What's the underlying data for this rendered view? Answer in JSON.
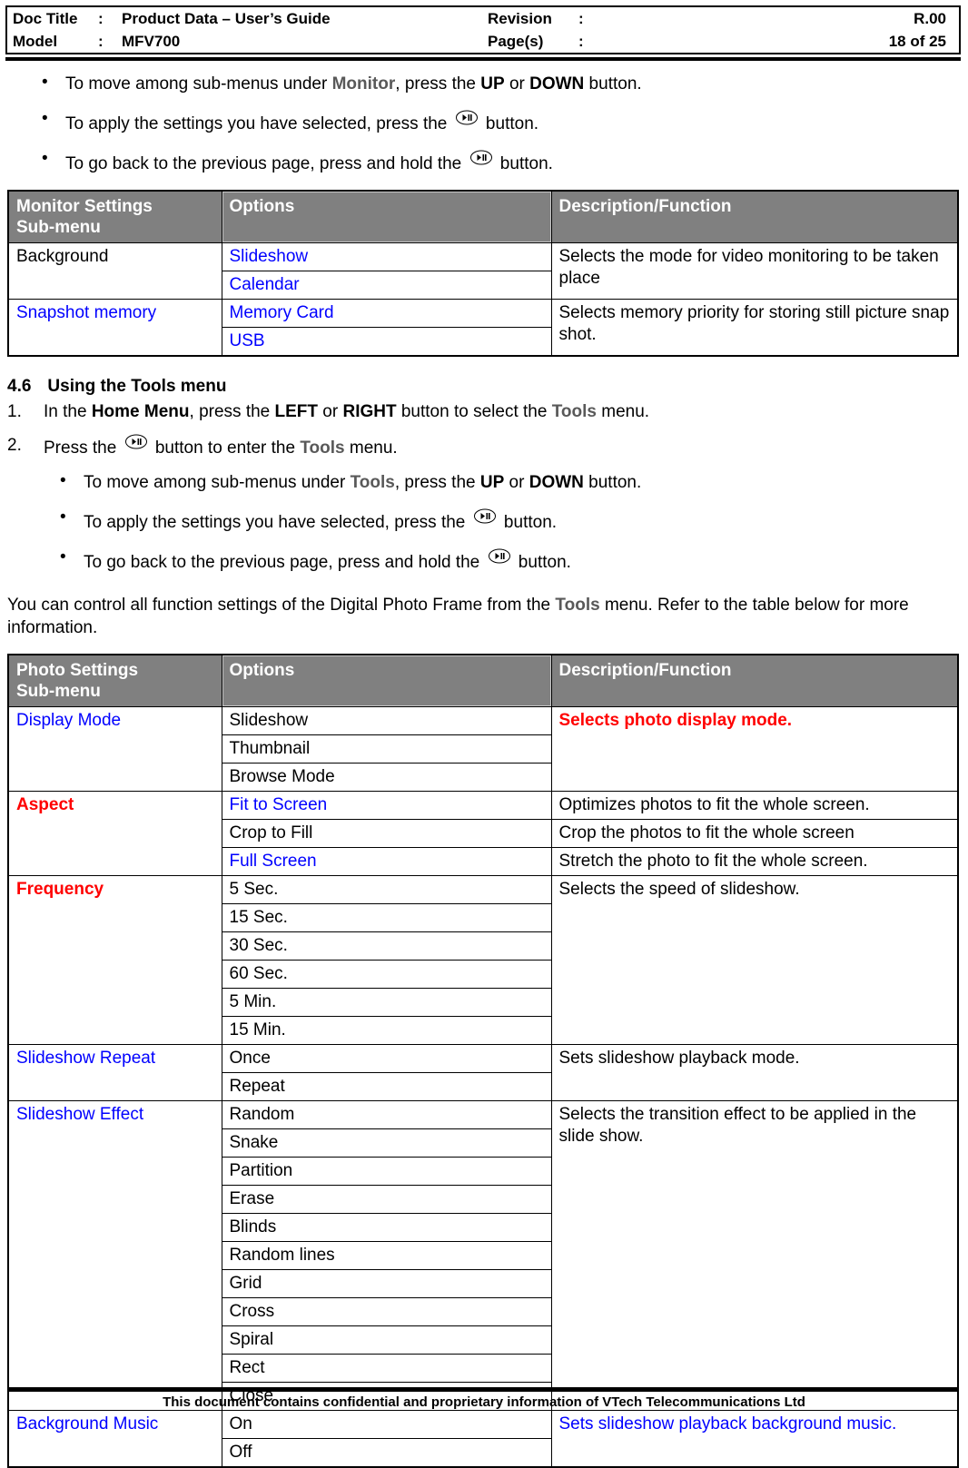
{
  "doc_header": {
    "doc_title_label": "Doc Title",
    "doc_title_colon": ":",
    "doc_title_value": "Product Data – User’s Guide",
    "model_label": "Model",
    "model_colon": ":",
    "model_value": "MFV700",
    "revision_label": "Revision",
    "revision_colon": ":",
    "revision_value": "R.00",
    "pages_label": "Page(s)",
    "pages_colon": ":",
    "pages_value": "18 of 25"
  },
  "monitor_bullets": [
    {
      "pre": "To move among sub-menus under ",
      "keyword": "Monitor",
      "mid": ", press the ",
      "bold1": "UP",
      "mid2": " or ",
      "bold2": "DOWN",
      "post": " button."
    },
    {
      "pre": "To apply the settings you have selected, press the ",
      "icon": "play-pause-button-icon",
      "post": " button."
    },
    {
      "pre": "To go back to the previous page, press and hold the ",
      "icon": "play-pause-button-icon",
      "post": " button."
    }
  ],
  "monitor_table": {
    "headers": [
      "Monitor Settings Sub-menu",
      "Options",
      "Description/Function"
    ],
    "header_line1": "Monitor Settings",
    "header_line2": "Sub-menu",
    "rows": [
      {
        "submenu": "Background",
        "submenu_color": "black",
        "options": [
          {
            "text": "Slideshow",
            "color": "blue"
          },
          {
            "text": "Calendar",
            "color": "blue"
          }
        ],
        "description": "Selects the mode for video monitoring to be taken place",
        "description_color": "black"
      },
      {
        "submenu": "Snapshot memory",
        "submenu_color": "blue",
        "options": [
          {
            "text": "Memory Card",
            "color": "blue"
          },
          {
            "text": "USB",
            "color": "blue"
          }
        ],
        "description": "Selects memory priority for storing still picture snap shot.",
        "description_color": "black"
      }
    ]
  },
  "section": {
    "number": "4.6",
    "title": "Using the Tools menu",
    "step1": {
      "pre": "In the ",
      "bold1": "Home Menu",
      "mid1": ", press the ",
      "bold2": "LEFT",
      "mid2": " or ",
      "bold3": "RIGHT",
      "mid3": " button to select the ",
      "keyword": "Tools",
      "post": " menu."
    },
    "step2": {
      "pre": "Press the ",
      "icon": "play-pause-button-icon",
      "mid": " button to enter the ",
      "keyword": "Tools",
      "post": " menu."
    }
  },
  "tools_bullets": [
    {
      "pre": "To move among sub-menus under ",
      "keyword": "Tools",
      "mid": ", press the ",
      "bold1": "UP",
      "mid2": " or ",
      "bold2": "DOWN",
      "post": " button."
    },
    {
      "pre": "To apply the settings you have selected, press the ",
      "icon": "play-pause-button-icon",
      "post": " button."
    },
    {
      "pre": "To go back to the previous page, press and hold the ",
      "icon": "play-pause-button-icon",
      "post": " button."
    }
  ],
  "intro_paragraph": {
    "pre": "You can control all function settings of the Digital Photo Frame from the ",
    "keyword": "Tools",
    "post": " menu. Refer to the table below for more information."
  },
  "photo_table": {
    "header_line1": "Photo Settings",
    "header_line2": "Sub-menu",
    "header_options": "Options",
    "header_description": "Description/Function",
    "rows": [
      {
        "submenu": "Display Mode",
        "submenu_color": "blue",
        "options": [
          {
            "text": "Slideshow",
            "color": "black"
          },
          {
            "text": "Thumbnail",
            "color": "black"
          },
          {
            "text": "Browse Mode",
            "color": "black"
          }
        ],
        "descriptions": [
          {
            "text": "Selects photo display mode.",
            "color": "red",
            "span": 3
          }
        ]
      },
      {
        "submenu": "Aspect",
        "submenu_color": "red",
        "options": [
          {
            "text": "Fit to Screen",
            "color": "blue"
          },
          {
            "text": "Crop to Fill",
            "color": "black"
          },
          {
            "text": "Full Screen",
            "color": "blue"
          }
        ],
        "descriptions": [
          {
            "text": "Optimizes photos to fit the whole screen.",
            "color": "black",
            "span": 1
          },
          {
            "text": "Crop the photos to fit the whole screen",
            "color": "black",
            "span": 1
          },
          {
            "text": "Stretch the photo to fit the whole screen.",
            "color": "black",
            "span": 1
          }
        ]
      },
      {
        "submenu": "Frequency",
        "submenu_color": "red",
        "options": [
          {
            "text": "5 Sec.",
            "color": "black"
          },
          {
            "text": "15 Sec.",
            "color": "black"
          },
          {
            "text": "30 Sec.",
            "color": "black"
          },
          {
            "text": "60 Sec.",
            "color": "black"
          },
          {
            "text": "5 Min.",
            "color": "black"
          },
          {
            "text": "15 Min.",
            "color": "black"
          }
        ],
        "descriptions": [
          {
            "text": "Selects the speed of slideshow.",
            "color": "black",
            "span": 6
          }
        ]
      },
      {
        "submenu": "Slideshow Repeat",
        "submenu_color": "blue",
        "options": [
          {
            "text": "Once",
            "color": "black"
          },
          {
            "text": "Repeat",
            "color": "black"
          }
        ],
        "descriptions": [
          {
            "text": "Sets slideshow playback mode.",
            "color": "black",
            "span": 2
          }
        ]
      },
      {
        "submenu": "Slideshow Effect",
        "submenu_color": "blue",
        "options": [
          {
            "text": "Random",
            "color": "black"
          },
          {
            "text": "Snake",
            "color": "black"
          },
          {
            "text": "Partition",
            "color": "black"
          },
          {
            "text": "Erase",
            "color": "black"
          },
          {
            "text": "Blinds",
            "color": "black"
          },
          {
            "text": "Random lines",
            "color": "black"
          },
          {
            "text": "Grid",
            "color": "black"
          },
          {
            "text": "Cross",
            "color": "black"
          },
          {
            "text": "Spiral",
            "color": "black"
          },
          {
            "text": "Rect",
            "color": "black"
          },
          {
            "text": "Close",
            "color": "black"
          }
        ],
        "descriptions": [
          {
            "text": "Selects the transition effect to be applied in the slide show.",
            "color": "black",
            "span": 11
          }
        ]
      },
      {
        "submenu": "Background Music",
        "submenu_color": "blue",
        "options": [
          {
            "text": "On",
            "color": "black"
          },
          {
            "text": "Off",
            "color": "black"
          }
        ],
        "descriptions": [
          {
            "text": "Sets slideshow playback background music.",
            "color": "blue",
            "span": 2
          }
        ]
      }
    ]
  },
  "footer": {
    "text": "This document contains confidential and proprietary information of VTech Telecommunications Ltd"
  },
  "colors": {
    "header_gray": "#808080",
    "keyword_gray": "#595959",
    "blue": "#0000FF",
    "red": "#FF0000",
    "black": "#000000"
  }
}
